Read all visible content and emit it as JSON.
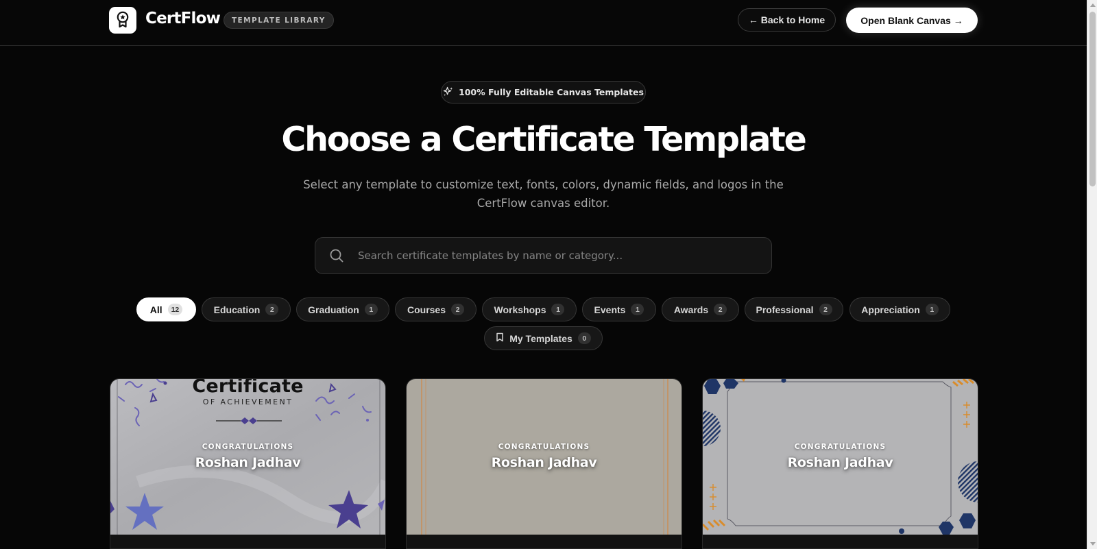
{
  "header": {
    "brand": "CertFlow",
    "badge": "TEMPLATE LIBRARY",
    "back_label": "← Back to Home",
    "blank_label": "Open Blank Canvas →"
  },
  "hero": {
    "pill": "100% Fully Editable Canvas Templates",
    "title": "Choose a Certificate Template",
    "subtitle": "Select any template to customize text, fonts, colors, dynamic fields, and logos in the CertFlow canvas editor."
  },
  "search": {
    "placeholder": "Search certificate templates by name or category..."
  },
  "filters": [
    {
      "label": "All",
      "count": "12",
      "active": true
    },
    {
      "label": "Education",
      "count": "2"
    },
    {
      "label": "Graduation",
      "count": "1"
    },
    {
      "label": "Courses",
      "count": "2"
    },
    {
      "label": "Workshops",
      "count": "1"
    },
    {
      "label": "Events",
      "count": "1"
    },
    {
      "label": "Awards",
      "count": "2"
    },
    {
      "label": "Professional",
      "count": "2"
    },
    {
      "label": "Appreciation",
      "count": "1"
    },
    {
      "label": "My Templates",
      "count": "0"
    }
  ],
  "cards": [
    {
      "heading": "Certificate",
      "subheading": "OF ACHIEVEMENT",
      "congrats": "CONGRATULATIONS",
      "name": "Roshan Jadhav"
    },
    {
      "congrats": "CONGRATULATIONS",
      "name": "Roshan Jadhav"
    },
    {
      "congrats": "CONGRATULATIONS",
      "name": "Roshan Jadhav"
    }
  ],
  "colors": {
    "background": "#060606",
    "card_preview": "#b4b4b4",
    "confetti_purple": "#4a3f8f",
    "geometric_navy": "#1f3566",
    "geometric_orange": "#d98c2b"
  },
  "icons": [
    "award-icon",
    "sparkle-icon",
    "search-icon",
    "bookmark-icon"
  ]
}
